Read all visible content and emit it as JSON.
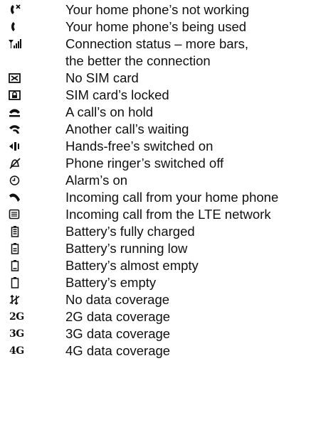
{
  "items": [
    {
      "icon": "phone-not-working-icon",
      "label": "Your home phone’s not working"
    },
    {
      "icon": "phone-in-use-icon",
      "label": "Your home phone’s being used"
    },
    {
      "icon": "signal-bars-icon",
      "label": "Connection status – more bars,",
      "label2": "the better the connection"
    },
    {
      "icon": "no-sim-icon",
      "label": "No SIM card"
    },
    {
      "icon": "sim-locked-icon",
      "label": "SIM card’s locked"
    },
    {
      "icon": "call-on-hold-icon",
      "label": "A call’s on hold"
    },
    {
      "icon": "call-waiting-icon",
      "label": "Another call’s waiting"
    },
    {
      "icon": "speaker-icon",
      "label": "Hands-free’s switched on"
    },
    {
      "icon": "ringer-off-icon",
      "label": "Phone ringer’s switched off"
    },
    {
      "icon": "alarm-icon",
      "label": "Alarm’s on"
    },
    {
      "icon": "incoming-home-call-icon",
      "label": "Incoming call from your home phone"
    },
    {
      "icon": "incoming-lte-call-icon",
      "label": "Incoming call from the LTE network"
    },
    {
      "icon": "battery-full-icon",
      "label": "Battery’s fully charged"
    },
    {
      "icon": "battery-low-icon",
      "label": "Battery’s running low"
    },
    {
      "icon": "battery-almost-empty-icon",
      "label": "Battery’s almost empty"
    },
    {
      "icon": "battery-empty-icon",
      "label": "Battery’s empty"
    },
    {
      "icon": "no-data-icon",
      "label": "No data coverage"
    },
    {
      "icon": "2g-icon",
      "glyph": "2G",
      "label": "2G data coverage"
    },
    {
      "icon": "3g-icon",
      "glyph": "3G",
      "label": "3G data coverage"
    },
    {
      "icon": "4g-icon",
      "glyph": "4G",
      "label": "4G data coverage"
    }
  ]
}
